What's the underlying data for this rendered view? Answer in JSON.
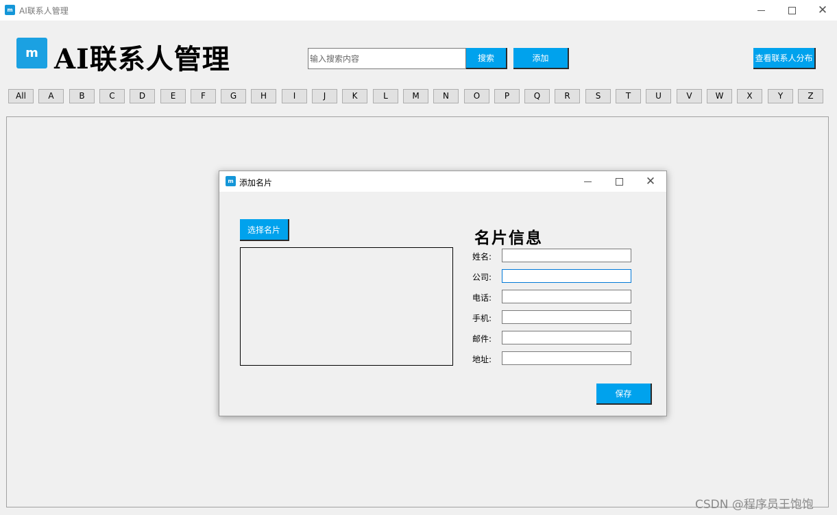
{
  "window": {
    "title": "AI联系人管理",
    "icon_text": "m"
  },
  "header": {
    "logo_text": "m",
    "app_title": "AI联系人管理",
    "search_placeholder": "输入搜索内容",
    "search_button": "搜索",
    "add_button": "添加",
    "distribution_button": "查看联系人分布"
  },
  "letters": [
    "All",
    "A",
    "B",
    "C",
    "D",
    "E",
    "F",
    "G",
    "H",
    "I",
    "J",
    "K",
    "L",
    "M",
    "N",
    "O",
    "P",
    "Q",
    "R",
    "S",
    "T",
    "U",
    "V",
    "W",
    "X",
    "Y",
    "Z"
  ],
  "dialog": {
    "title": "添加名片",
    "icon_text": "m",
    "choose_button": "选择名片",
    "info_heading": "名片信息",
    "fields": [
      {
        "key": "name",
        "label": "姓名:",
        "value": ""
      },
      {
        "key": "company",
        "label": "公司:",
        "value": "",
        "focused": true
      },
      {
        "key": "phone",
        "label": "电话:",
        "value": ""
      },
      {
        "key": "mobile",
        "label": "手机:",
        "value": ""
      },
      {
        "key": "email",
        "label": "邮件:",
        "value": ""
      },
      {
        "key": "address",
        "label": "地址:",
        "value": ""
      }
    ],
    "save_button": "保存"
  },
  "watermark": "CSDN @程序员王饱饱",
  "colors": {
    "accent_button": "#00a2ed",
    "logo": "#1ba1e2",
    "focus_border": "#0078d7"
  }
}
